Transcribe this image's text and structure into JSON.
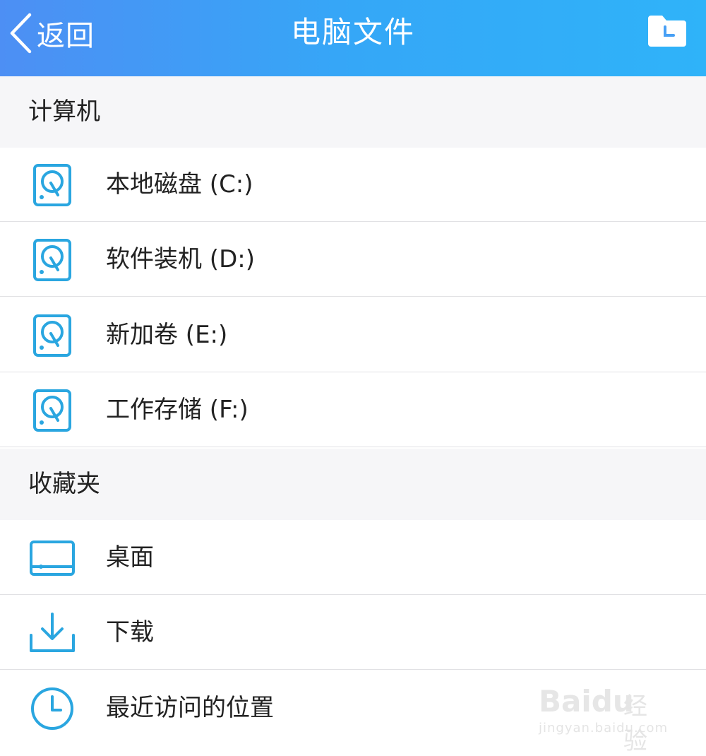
{
  "header": {
    "back_label": "返回",
    "title": "电脑文件",
    "gradient_start": "#4d8ff4",
    "gradient_end": "#2fb3f9"
  },
  "computer_section": {
    "title": "计算机",
    "items": [
      {
        "label": "本地磁盘 (C:)",
        "icon": "hard-drive-icon"
      },
      {
        "label": "软件装机 (D:)",
        "icon": "hard-drive-icon"
      },
      {
        "label": "新加卷 (E:)",
        "icon": "hard-drive-icon"
      },
      {
        "label": "工作存储 (F:)",
        "icon": "hard-drive-icon"
      }
    ]
  },
  "favorites_section": {
    "title": "收藏夹",
    "items": [
      {
        "label": "桌面",
        "icon": "desktop-icon"
      },
      {
        "label": "下载",
        "icon": "download-icon"
      },
      {
        "label": "最近访问的位置",
        "icon": "clock-icon"
      }
    ]
  },
  "watermark": {
    "logo": "Baidu",
    "name": "经验",
    "url": "jingyan.baidu.com"
  },
  "accent_color": "#2aa6e0"
}
